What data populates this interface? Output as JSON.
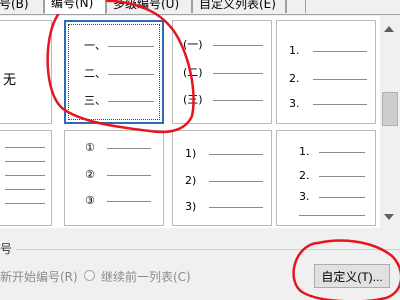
{
  "tabs": [
    {
      "label": "号(B)"
    },
    {
      "label": "编号(N)",
      "active": true
    },
    {
      "label": "多级编号(U)"
    },
    {
      "label": "自定义列表(E)"
    },
    {
      "label": ""
    }
  ],
  "gallery": {
    "none_label": "无",
    "cells": [
      {
        "id": "chinese",
        "labels": [
          "一、",
          "二、",
          "三、"
        ],
        "selected": true
      },
      {
        "id": "paren-chinese",
        "labels": [
          "(一)",
          "(二)",
          "(三)"
        ]
      },
      {
        "id": "arabic-dot",
        "labels": [
          "1.",
          "2.",
          "3."
        ]
      },
      {
        "id": "circled",
        "labels": [
          "①",
          "②",
          "③"
        ]
      },
      {
        "id": "arabic-paren",
        "labels": [
          "1)",
          "2)",
          "3)"
        ]
      },
      {
        "id": "arabic-dot-2",
        "labels": [
          "1.",
          "2.",
          "3."
        ]
      }
    ]
  },
  "section": {
    "label": "号",
    "restart_label": "新开始编号(R)",
    "continue_label": "继续前一列表(C)"
  },
  "custom_button": {
    "label": "自定义(T)..."
  },
  "colors": {
    "selection": "#2b6cb8",
    "annotation": "#e8141e"
  }
}
